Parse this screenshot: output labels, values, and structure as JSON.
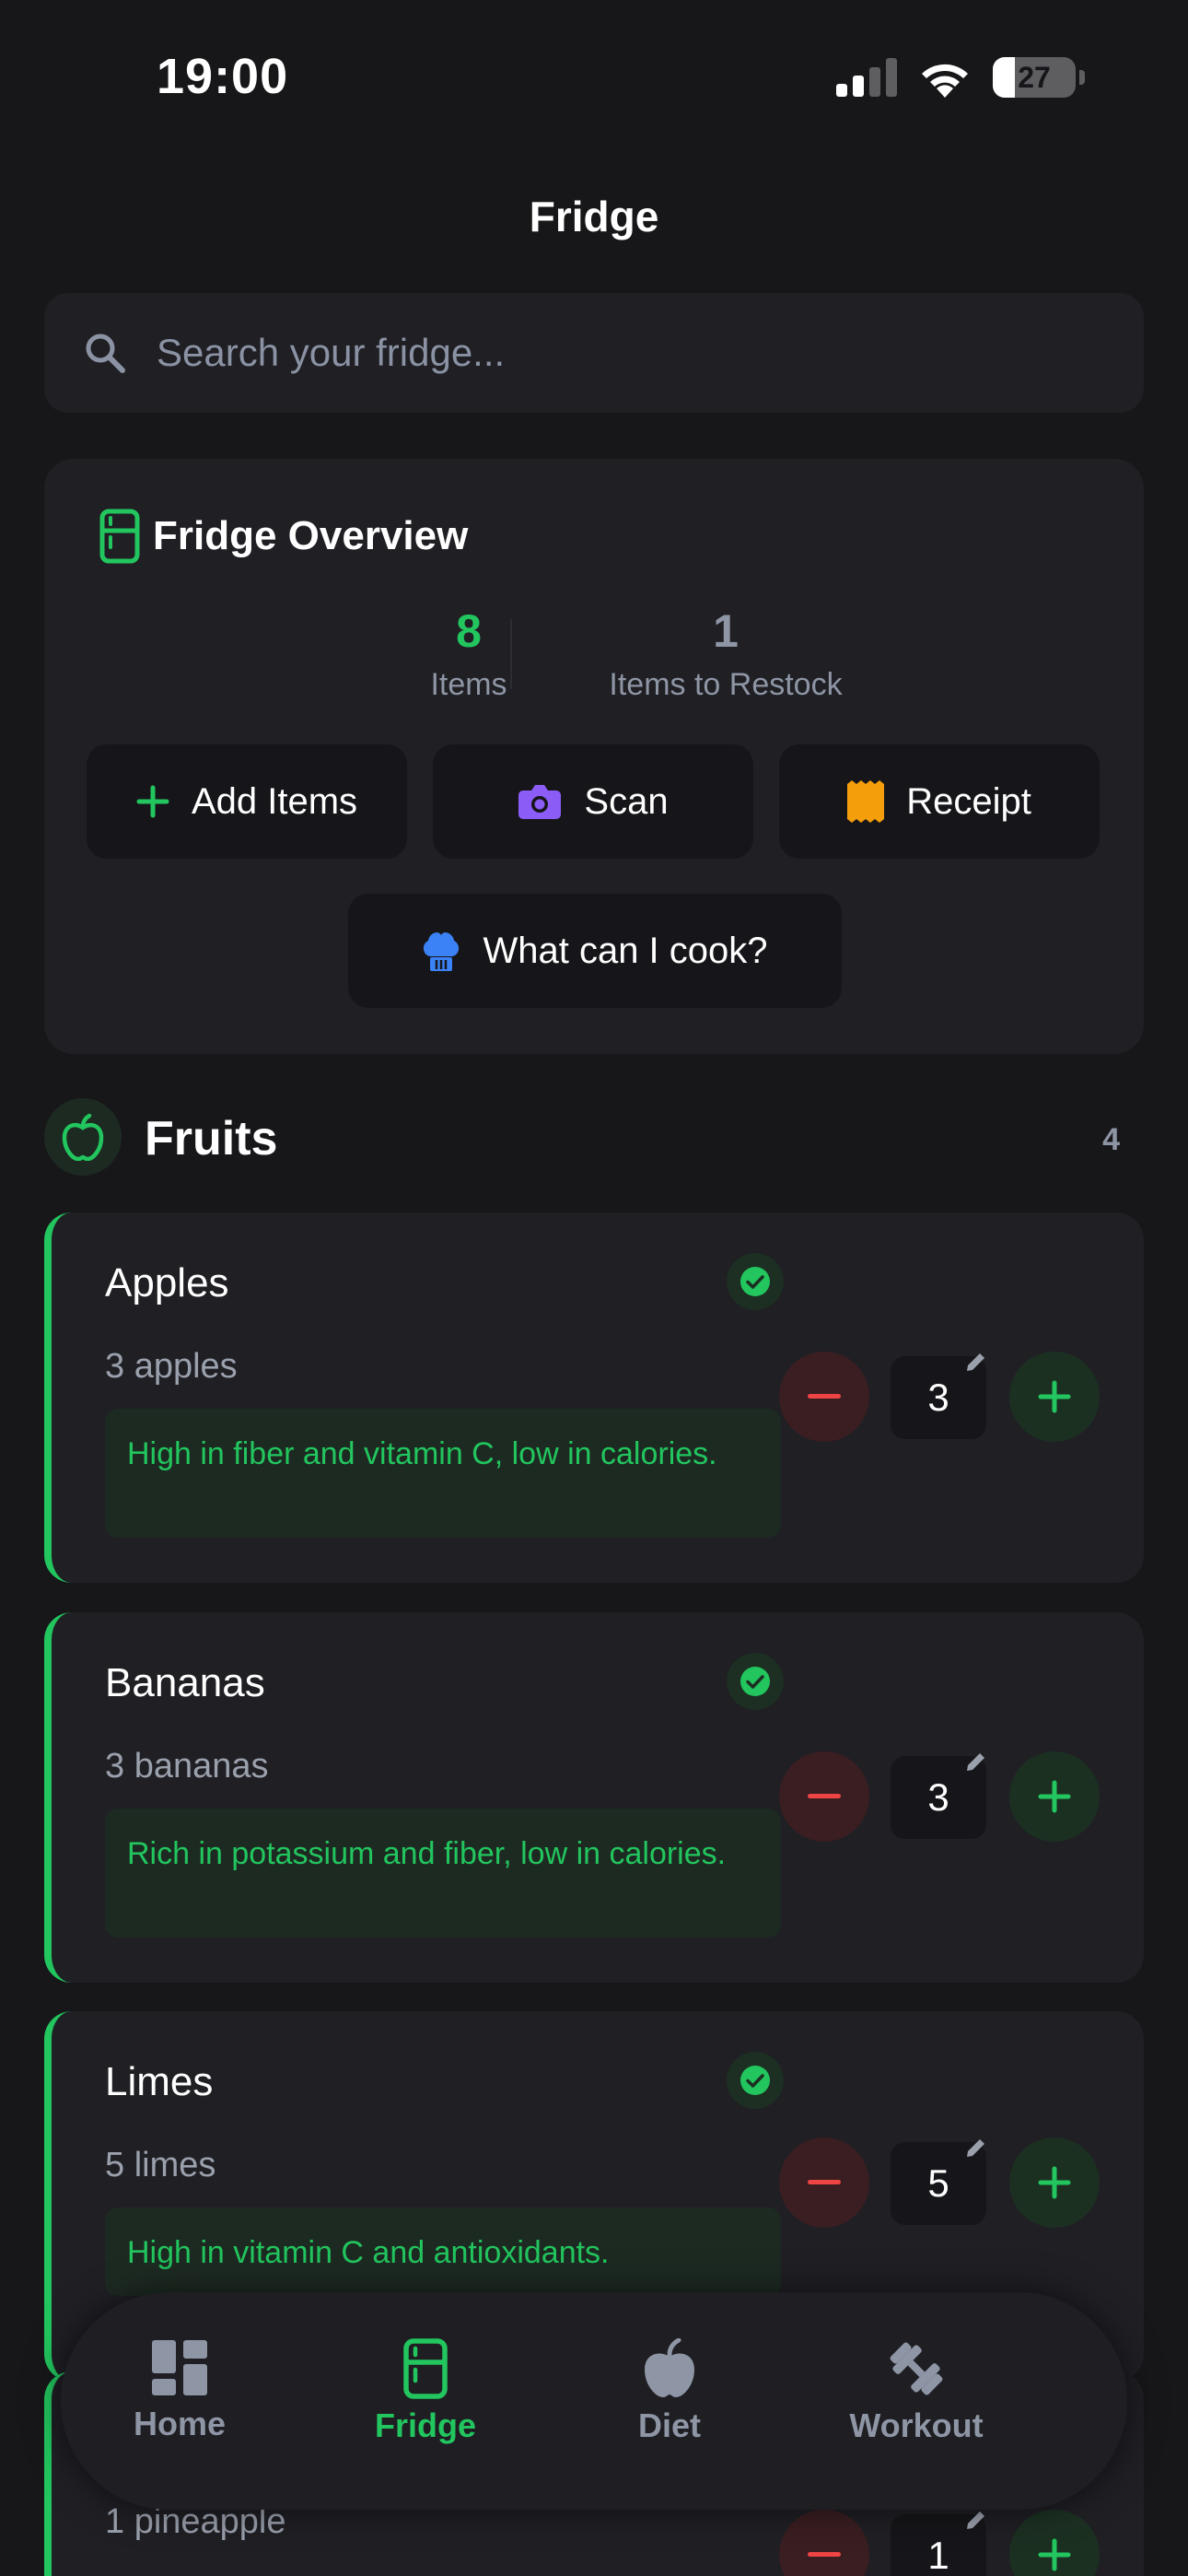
{
  "status_bar": {
    "time": "19:00",
    "battery": "27"
  },
  "page": {
    "title": "Fridge"
  },
  "search": {
    "placeholder": "Search your fridge..."
  },
  "overview": {
    "title": "Fridge Overview",
    "items_count": "8",
    "items_label": "Items",
    "restock_count": "1",
    "restock_label": "Items to Restock",
    "buttons": {
      "add": "Add Items",
      "scan": "Scan",
      "receipt": "Receipt",
      "cook": "What can I cook?"
    }
  },
  "section": {
    "title": "Fruits",
    "count": "4"
  },
  "items": [
    {
      "name": "Apples",
      "qty_text": "3 apples",
      "note": "High in fiber and vitamin C, low in calories.",
      "qty": "3"
    },
    {
      "name": "Bananas",
      "qty_text": "3 bananas",
      "note": "Rich in potassium and fiber, low in calories.",
      "qty": "3"
    },
    {
      "name": "Limes",
      "qty_text": "5 limes",
      "note": "High in vitamin C and antioxidants.",
      "qty": "5"
    },
    {
      "name": "",
      "qty_text": "1 pineapple",
      "note": "",
      "qty": "1"
    }
  ],
  "tabs": [
    {
      "label": "Home",
      "icon": "dashboard-icon",
      "active": false
    },
    {
      "label": "Fridge",
      "icon": "fridge-icon",
      "active": true
    },
    {
      "label": "Diet",
      "icon": "apple-icon",
      "active": false
    },
    {
      "label": "Workout",
      "icon": "dumbbell-icon",
      "active": false
    }
  ],
  "colors": {
    "accent": "#22c55e",
    "background": "#17171a",
    "card": "#1f1f24",
    "danger": "#ef4444",
    "scan": "#8b5cf6",
    "receipt": "#f59e0b",
    "cook": "#3b82f6"
  }
}
